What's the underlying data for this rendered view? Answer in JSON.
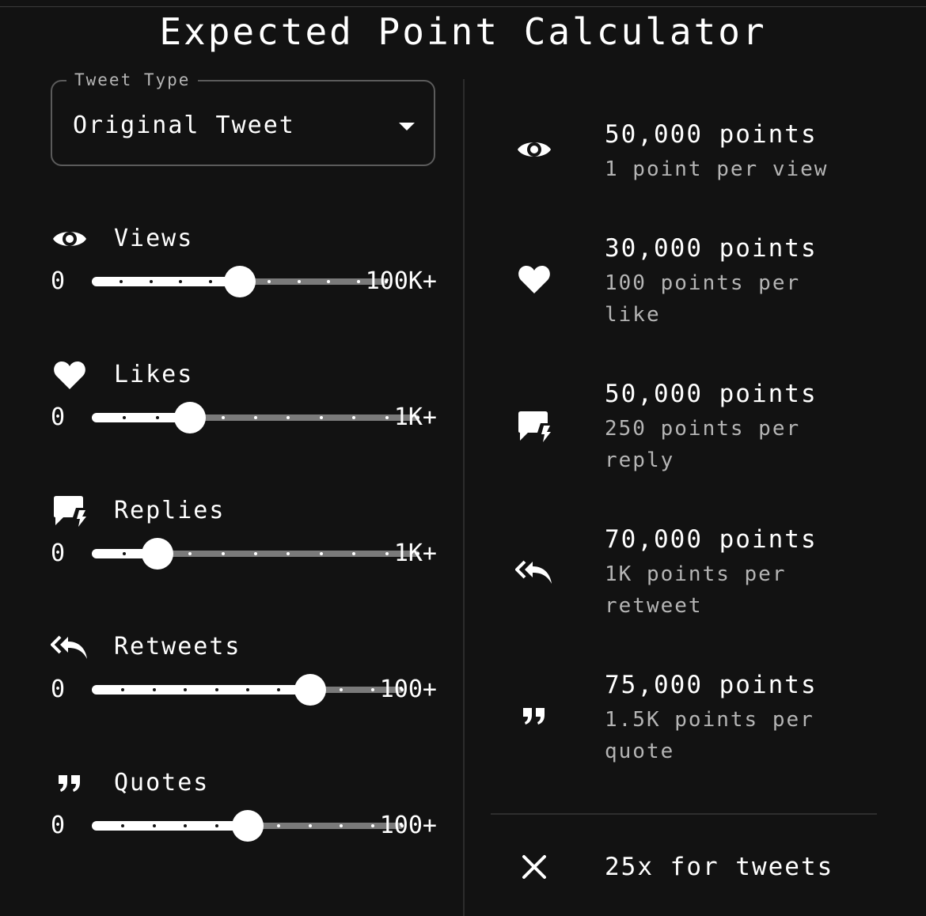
{
  "title": "Expected Point Calculator",
  "tweet_type": {
    "label": "Tweet Type",
    "value": "Original Tweet"
  },
  "sliders": [
    {
      "icon": "eye-icon",
      "label": "Views",
      "min": "0",
      "max": "100K+",
      "value": 0.5,
      "ticks": 10
    },
    {
      "icon": "heart-icon",
      "label": "Likes",
      "min": "0",
      "max": "1K+",
      "value": 0.3,
      "ticks": 10
    },
    {
      "icon": "reply-icon",
      "label": "Replies",
      "min": "0",
      "max": "1K+",
      "value": 0.2,
      "ticks": 10
    },
    {
      "icon": "retweet-icon",
      "label": "Retweets",
      "min": "0",
      "max": "100+",
      "value": 0.7,
      "ticks": 10
    },
    {
      "icon": "quote-icon",
      "label": "Quotes",
      "min": "0",
      "max": "100+",
      "value": 0.5,
      "ticks": 10
    }
  ],
  "summary": [
    {
      "icon": "eye-icon",
      "points": "50,000 points",
      "rate": "1 point per view"
    },
    {
      "icon": "heart-icon",
      "points": "30,000 points",
      "rate": "100 points per like"
    },
    {
      "icon": "reply-icon",
      "points": "50,000 points",
      "rate": "250 points per reply"
    },
    {
      "icon": "retweet-icon",
      "points": "70,000 points",
      "rate": "1K points per retweet"
    },
    {
      "icon": "quote-icon",
      "points": "75,000 points",
      "rate": "1.5K points per quote"
    }
  ],
  "multiplier": {
    "icon": "close-icon",
    "text": "25x for tweets"
  },
  "colors": {
    "background": "#121212",
    "accent": "#ffffff",
    "muted": "#b5b5b5",
    "track": "#7a7a7a"
  }
}
